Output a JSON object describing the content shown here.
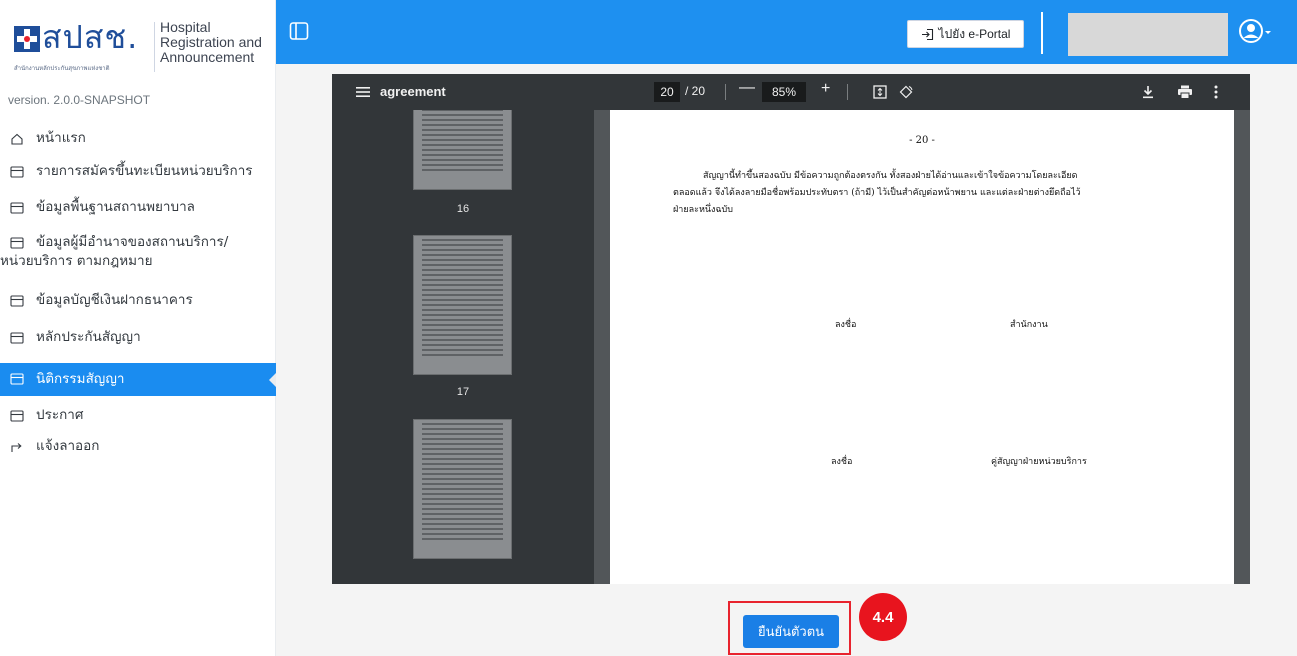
{
  "brand": {
    "thai_logo": "สปสช.",
    "thai_sub": "สำนักงานหลักประกันสุขภาพแห่งชาติ",
    "line1": "Hospital",
    "line2": "Registration and",
    "line3": "Announcement",
    "version": "version. 2.0.0-SNAPSHOT"
  },
  "sidebar": {
    "items": [
      {
        "label": "หน้าแรก",
        "icon": "home-icon"
      },
      {
        "label": "รายการสมัครขึ้นทะเบียนหน่วยบริการ",
        "icon": "list-icon"
      },
      {
        "label": "ข้อมูลพื้นฐานสถานพยาบาล",
        "icon": "list-icon"
      },
      {
        "label": "ข้อมูลผู้มีอำนาจของสถานบริการ/",
        "label2": "หน่วยบริการ ตามกฎหมาย",
        "icon": "list-icon"
      },
      {
        "label": "ข้อมูลบัญชีเงินฝากธนาคาร",
        "icon": "list-icon"
      },
      {
        "label": "หลักประกันสัญญา",
        "icon": "list-icon"
      },
      {
        "label": "นิติกรรมสัญญา",
        "icon": "list-icon",
        "active": true
      },
      {
        "label": "ประกาศ",
        "icon": "list-icon"
      },
      {
        "label": "แจ้งลาออก",
        "icon": "logout-icon"
      }
    ]
  },
  "header": {
    "eportal_label": "ไปยัง e-Portal",
    "colors": {
      "topbar": "#1e90f0",
      "active_nav": "#1a8cf0"
    }
  },
  "viewer": {
    "title": "agreement",
    "current_page": "20",
    "total_pages": "/ 20",
    "zoom": "85%",
    "zoom_out": "—",
    "zoom_in": "+",
    "thumb_labels": [
      "16",
      "17"
    ]
  },
  "page": {
    "number": "- 20 -",
    "paragraph_line1": "สัญญานี้ทำขึ้นสองฉบับ มีข้อความถูกต้องตรงกัน ทั้งสองฝ่ายได้อ่านและเข้าใจข้อความโดยละเอียด",
    "paragraph_line2": "ตลอดแล้ว จึงได้ลงลายมือชื่อพร้อมประทับตรา (ถ้ามี) ไว้เป็นสำคัญต่อหน้าพยาน และแต่ละฝ่ายต่างยึดถือไว้",
    "paragraph_line3": "ฝ่ายละหนึ่งฉบับ",
    "sign1_label": "ลงชื่อ",
    "sign1_party": "สำนักงาน",
    "sign2_label": "ลงชื่อ",
    "sign2_party": "คู่สัญญาฝ่ายหน่วยบริการ"
  },
  "actions": {
    "confirm_label": "ยืนยันตัวตน",
    "step_badge": "4.4"
  }
}
